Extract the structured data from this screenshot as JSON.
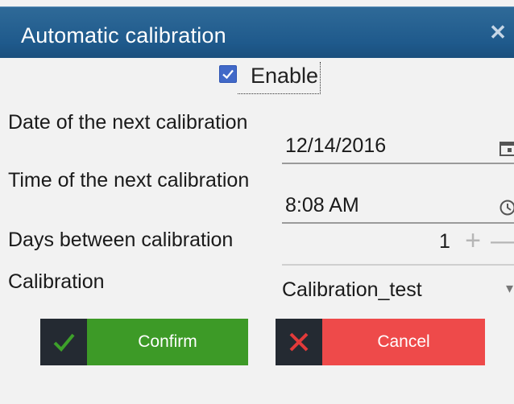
{
  "dialog": {
    "title": "Automatic calibration",
    "close_glyph": "✕"
  },
  "enable": {
    "label": "Enable",
    "checked": true
  },
  "fields": {
    "next_date": {
      "label": "Date of the next calibration",
      "value": "12/14/2016",
      "icon": "calendar-icon"
    },
    "next_time": {
      "label": "Time of the next calibration",
      "value": "8:08 AM",
      "icon": "clock-icon"
    },
    "days_between": {
      "label": "Days between calibration",
      "value": "1",
      "plus": "+",
      "minus": "—"
    },
    "calibration": {
      "label": "Calibration",
      "value": "Calibration_test",
      "chevron": "▾"
    }
  },
  "buttons": {
    "confirm": {
      "label": "Confirm",
      "color": "#3d9a27",
      "icon": "checkmark-icon"
    },
    "cancel": {
      "label": "Cancel",
      "color": "#ee4a4a",
      "icon": "x-icon"
    }
  }
}
